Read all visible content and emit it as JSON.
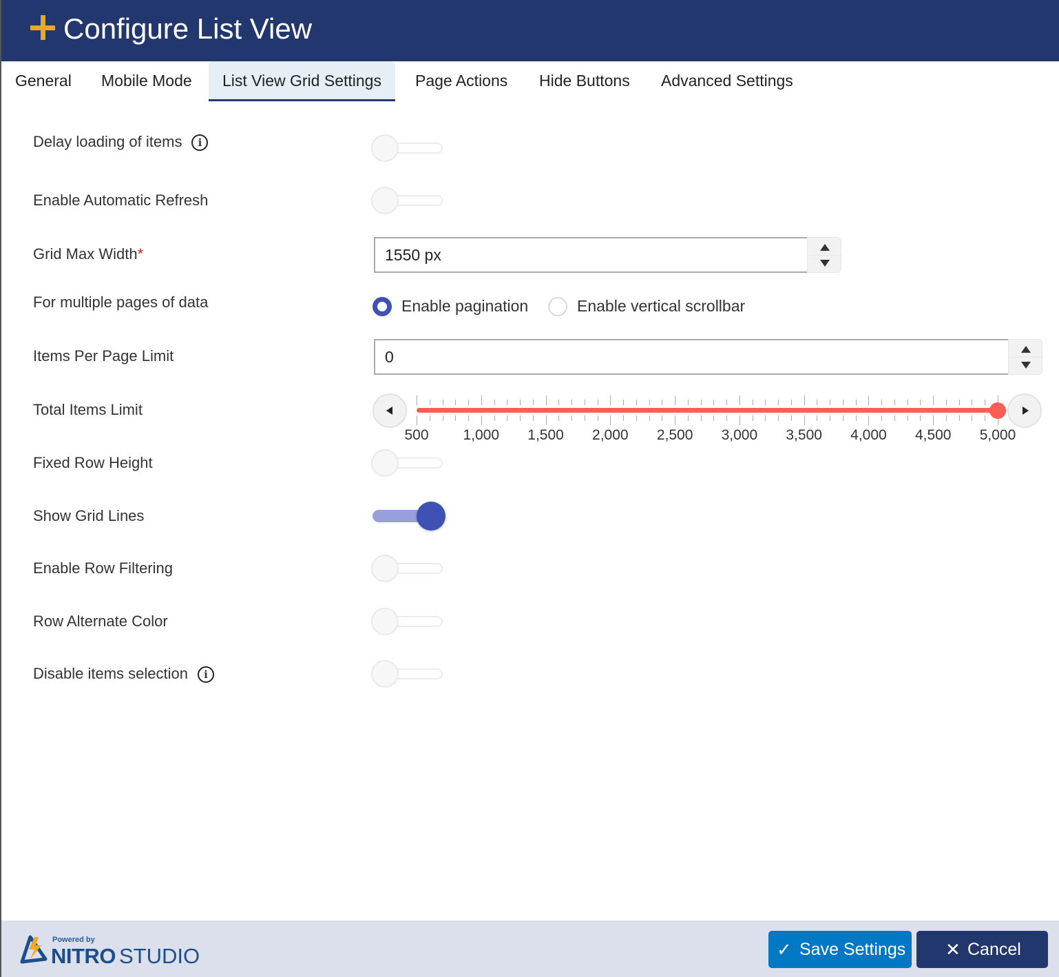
{
  "header": {
    "title": "Configure List View",
    "icon": "plus-icon",
    "icon_color": "#e8a825",
    "background": "#21376e"
  },
  "tabs": [
    {
      "label": "General",
      "active": false
    },
    {
      "label": "Mobile Mode",
      "active": false
    },
    {
      "label": "List View Grid Settings",
      "active": true
    },
    {
      "label": "Page Actions",
      "active": false
    },
    {
      "label": "Hide Buttons",
      "active": false
    },
    {
      "label": "Advanced Settings",
      "active": false
    }
  ],
  "settings": {
    "delay_loading": {
      "label": "Delay loading of items",
      "info_icon": "info-icon",
      "enabled": false
    },
    "auto_refresh": {
      "label": "Enable Automatic Refresh",
      "enabled": false
    },
    "grid_max_width": {
      "label": "Grid Max Width",
      "required_mark": "*",
      "value": "1550 px"
    },
    "multi_page": {
      "label": "For multiple pages of data",
      "options": [
        {
          "label": "Enable pagination",
          "checked": true
        },
        {
          "label": "Enable vertical scrollbar",
          "checked": false
        }
      ]
    },
    "items_per_page": {
      "label": "Items Per Page Limit",
      "value": "0"
    },
    "total_items_limit": {
      "label": "Total Items Limit",
      "min": 500,
      "max": 5000,
      "value": 5000,
      "major_step": 500,
      "minor_step": 100,
      "tick_labels": [
        "500",
        "1,000",
        "1,500",
        "2,000",
        "2,500",
        "3,000",
        "3,500",
        "4,000",
        "4,500",
        "5,000"
      ],
      "accent": "#ff5e57"
    },
    "fixed_row_height": {
      "label": "Fixed Row Height",
      "enabled": false
    },
    "show_grid_lines": {
      "label": "Show Grid Lines",
      "enabled": true
    },
    "row_filtering": {
      "label": "Enable Row Filtering",
      "enabled": false
    },
    "row_alt_color": {
      "label": "Row Alternate Color",
      "enabled": false
    },
    "disable_selection": {
      "label": "Disable items selection",
      "info_icon": "info-icon",
      "enabled": false
    }
  },
  "footer": {
    "powered_by": "Powered by",
    "brand_bold": "NITRO",
    "brand_light": "STUDIO",
    "save_label": "Save Settings",
    "save_icon": "✓",
    "cancel_label": "Cancel",
    "cancel_icon": "✕",
    "save_color": "#0078c3",
    "cancel_color": "#21376e"
  }
}
